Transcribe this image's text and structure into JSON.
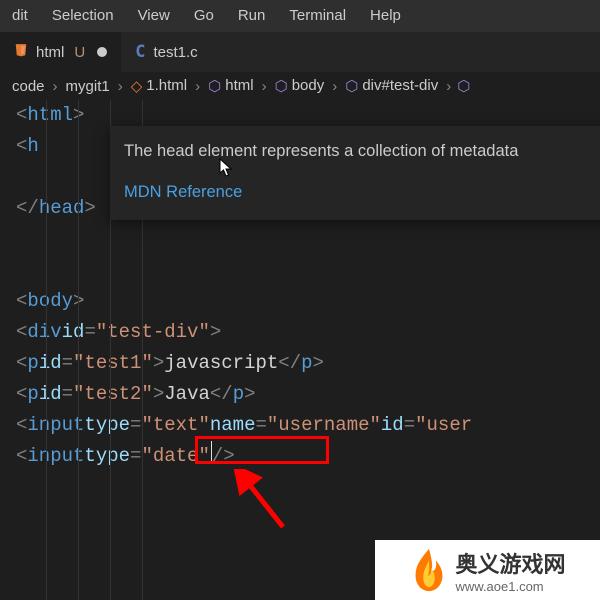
{
  "menu": {
    "items": [
      "dit",
      "Selection",
      "View",
      "Go",
      "Run",
      "Terminal",
      "Help"
    ]
  },
  "tabs": [
    {
      "label": "html",
      "modified_marker": "U",
      "active": true
    },
    {
      "label": "test1.c",
      "active": false
    }
  ],
  "breadcrumbs": {
    "segments": [
      "code",
      "mygit1",
      "1.html",
      "html",
      "body",
      "div#test-div"
    ]
  },
  "tooltip": {
    "text": "The head element represents a collection of metadata",
    "link": "MDN Reference"
  },
  "code": {
    "l1": {
      "open": "<",
      "tag": "html",
      "close": ">"
    },
    "l2": {
      "open": "<",
      "tag": "h"
    },
    "l3": {
      "open": "</",
      "tag": "head",
      "close": ">"
    },
    "l4": {
      "open": "<",
      "tag": "body",
      "close": ">"
    },
    "l5": {
      "open": "<",
      "tag": "div",
      "attr": "id",
      "eq": "=",
      "val": "\"test-div\"",
      "close": ">"
    },
    "l6": {
      "open": "<",
      "tag": "p",
      "attr": "id",
      "eq": "=",
      "val": "\"test1\"",
      "mid": ">",
      "text": "javascript",
      "copen": "</",
      "ctag": "p",
      "cclose": ">"
    },
    "l7": {
      "open": "<",
      "tag": "p",
      "attr": "id",
      "eq": "=",
      "val": "\"test2\"",
      "mid": ">",
      "text": "Java",
      "copen": "</",
      "ctag": "p",
      "cclose": ">"
    },
    "l8": {
      "open": "<",
      "tag": "input",
      "a1": "type",
      "e1": "=",
      "v1": "\"text\"",
      "a2": "name",
      "e2": "=",
      "v2": "\"username\"",
      "a3": "id",
      "e3": "=",
      "v3": "\"user"
    },
    "l9": {
      "open": "<",
      "tag": "input",
      "a1": "type",
      "e1": "=",
      "v1": "\"date\"",
      "close": "/>"
    }
  },
  "watermark": {
    "line1": "奥义游戏网",
    "line2": "www.aoe1.com"
  }
}
